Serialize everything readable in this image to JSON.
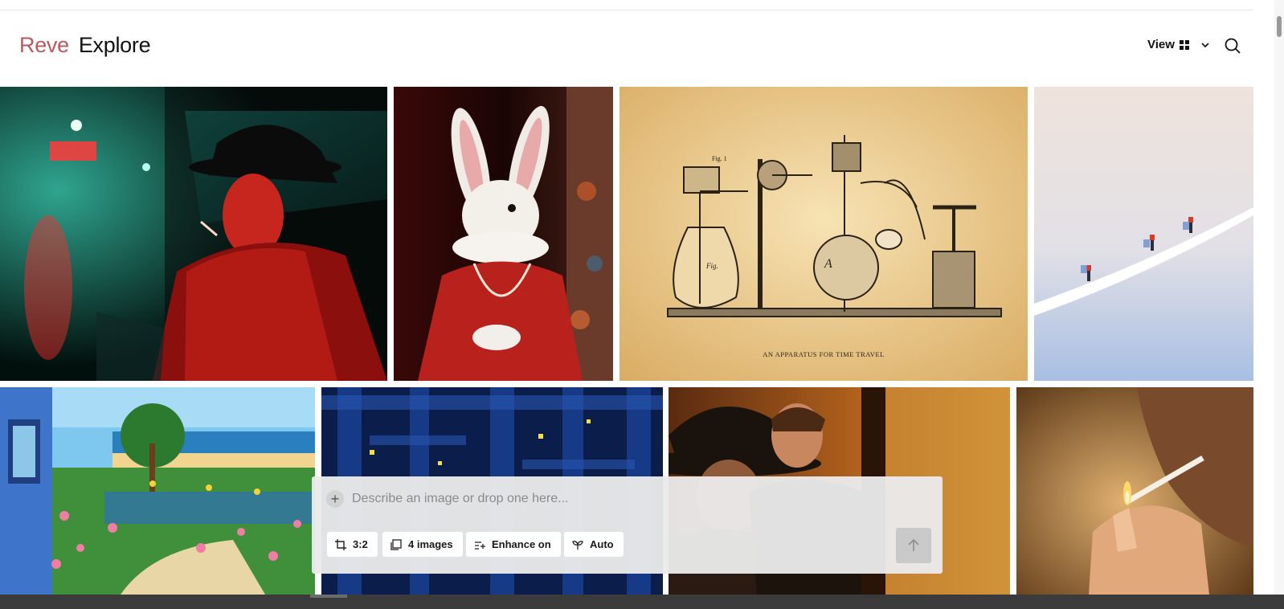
{
  "header": {
    "logo": "Reve",
    "section": "Explore",
    "view_label": "View",
    "grid_icon": "grid-icon",
    "chevron_icon": "chevron-down-icon",
    "search_icon": "search-icon"
  },
  "gallery": {
    "apparatus_caption": "AN APPARATUS FOR TIME TRAVEL",
    "apparatus_fig_1": "Fig. 1",
    "apparatus_fig": "Fig.",
    "apparatus_letter": "A"
  },
  "composer": {
    "placeholder": "Describe an image or drop one here...",
    "value": "",
    "add_icon": "plus-icon",
    "aspect_ratio": "3:2",
    "image_count": "4 images",
    "enhance": "Enhance on",
    "mode": "Auto",
    "send_icon": "arrow-up-icon"
  },
  "colors": {
    "brand": "#b85a63",
    "composer_bg": "#eaeaea"
  }
}
